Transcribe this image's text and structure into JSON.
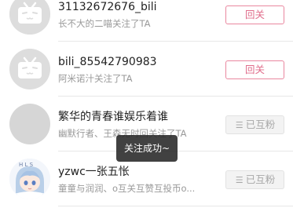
{
  "list": {
    "items": [
      {
        "username": "31132672676_bili",
        "subtitle": "长不大的二喵关注了TA",
        "button": "回关",
        "avatar": "bilibili-tv-icon"
      },
      {
        "username": "bili_85542790983",
        "subtitle": "阿米诺汁关注了TA",
        "button": "回关",
        "avatar": "bilibili-tv-icon"
      },
      {
        "username": "繁华的青春谁娱乐着谁",
        "subtitle": "幽默行者、王森无时回关注了TA",
        "button": "已互粉",
        "avatar": "grey-circle"
      },
      {
        "username": "yzwc一张五怅",
        "subtitle": "童童与润润、o互关互赞互投币o...",
        "button": "已互粉",
        "avatar": "anime-character"
      }
    ]
  },
  "toast": {
    "text": "关注成功~"
  },
  "colors": {
    "follow_accent": "#e06d8b",
    "mutual_bg": "#f3f3f3",
    "avatar_grey": "#d6d6d6"
  },
  "icons": {
    "mutual": "menu-lines-icon"
  }
}
